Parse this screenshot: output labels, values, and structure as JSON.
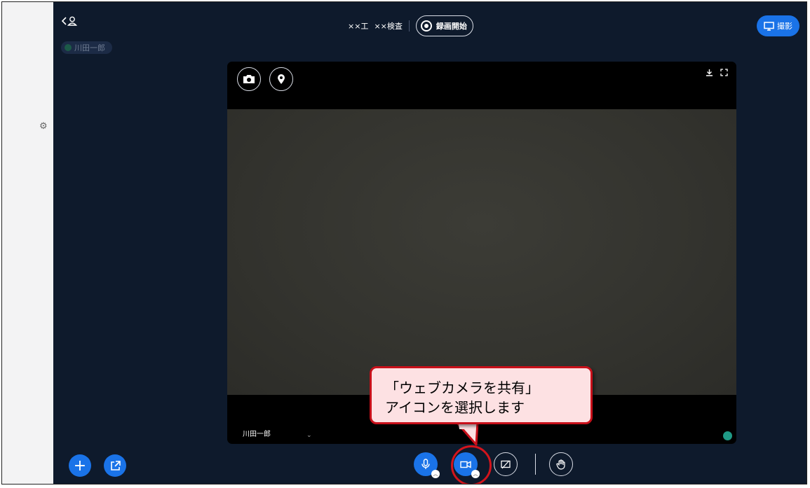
{
  "sidebar": {
    "icon": "gear-icon"
  },
  "header": {
    "back_icon": "chevron-left-icon",
    "user_icon": "user-icon",
    "participant_name": "川田一郎",
    "site_name": "××工",
    "inspection_name": "××検査",
    "record_label": "録画開始",
    "capture_label": "撮影"
  },
  "video": {
    "name_label": "川田一郎",
    "caret": "⌄"
  },
  "controls": {
    "add_label": "+",
    "items": [
      "microphone-icon",
      "video-camera-icon",
      "screen-share-off-icon",
      "raise-hand-icon"
    ]
  },
  "callout": {
    "line1": "「ウェブカメラを共有」",
    "line2": "アイコンを選択します"
  },
  "colors": {
    "background": "#0e1a2c",
    "accent": "#1a73e8",
    "callout_border": "#c8101a",
    "callout_fill": "#fde1e3"
  }
}
